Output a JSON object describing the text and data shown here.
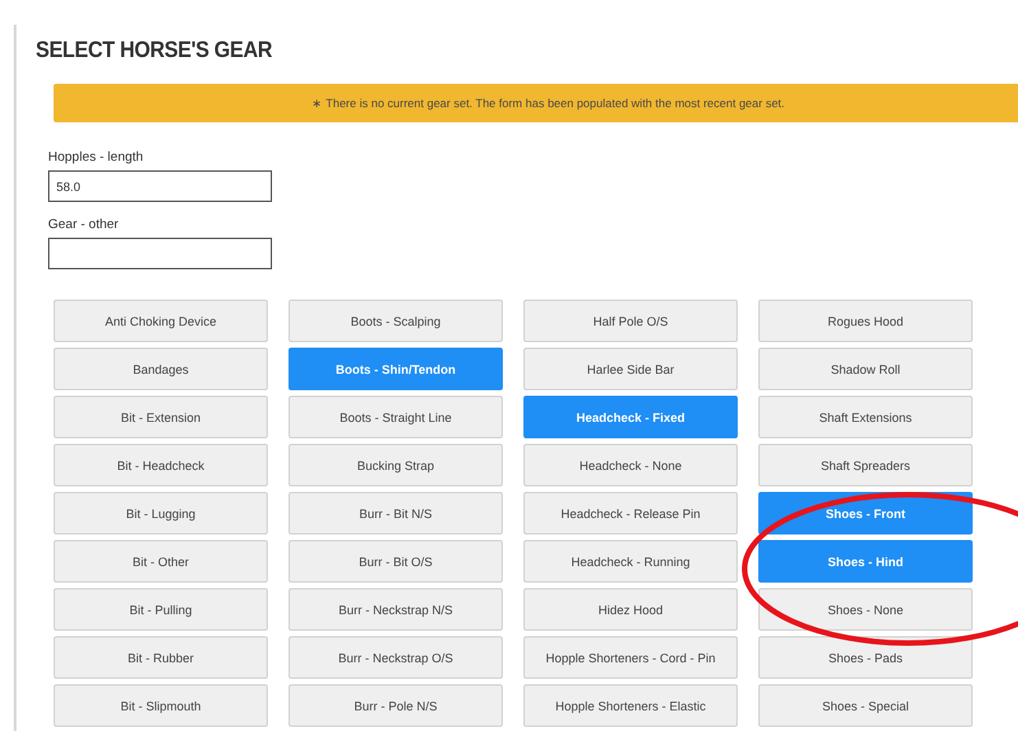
{
  "title": "SELECT HORSE'S GEAR",
  "notice": "∗ There is no current gear set. The form has been populated with the most recent gear set.",
  "fields": [
    {
      "label": "Hopples - length",
      "value": "58.0"
    },
    {
      "label": "Gear - other"
    }
  ],
  "gear_columns": [
    [
      {
        "label": "Anti Choking Device",
        "selected": false
      },
      {
        "label": "Bandages",
        "selected": false
      },
      {
        "label": "Bit - Extension",
        "selected": false
      },
      {
        "label": "Bit - Headcheck",
        "selected": false
      },
      {
        "label": "Bit - Lugging",
        "selected": false
      },
      {
        "label": "Bit - Other",
        "selected": false
      },
      {
        "label": "Bit - Pulling",
        "selected": false
      },
      {
        "label": "Bit - Rubber",
        "selected": false
      },
      {
        "label": "Bit - Slipmouth",
        "selected": false
      }
    ],
    [
      {
        "label": "Boots - Scalping",
        "selected": false
      },
      {
        "label": "Boots - Shin/Tendon",
        "selected": true
      },
      {
        "label": "Boots - Straight Line",
        "selected": false
      },
      {
        "label": "Bucking Strap",
        "selected": false
      },
      {
        "label": "Burr - Bit N/S",
        "selected": false
      },
      {
        "label": "Burr - Bit O/S",
        "selected": false
      },
      {
        "label": "Burr - Neckstrap N/S",
        "selected": false
      },
      {
        "label": "Burr - Neckstrap O/S",
        "selected": false
      },
      {
        "label": "Burr - Pole N/S",
        "selected": false
      }
    ],
    [
      {
        "label": "Half Pole O/S",
        "selected": false
      },
      {
        "label": "Harlee Side Bar",
        "selected": false
      },
      {
        "label": "Headcheck - Fixed",
        "selected": true
      },
      {
        "label": "Headcheck - None",
        "selected": false
      },
      {
        "label": "Headcheck - Release Pin",
        "selected": false
      },
      {
        "label": "Headcheck - Running",
        "selected": false
      },
      {
        "label": "Hidez Hood",
        "selected": false
      },
      {
        "label": "Hopple Shorteners - Cord - Pin",
        "selected": false
      },
      {
        "label": "Hopple Shorteners - Elastic",
        "selected": false
      }
    ],
    [
      {
        "label": "Rogues Hood",
        "selected": false
      },
      {
        "label": "Shadow Roll",
        "selected": false
      },
      {
        "label": "Shaft Extensions",
        "selected": false
      },
      {
        "label": "Shaft Spreaders",
        "selected": false
      },
      {
        "label": "Shoes - Front",
        "selected": true
      },
      {
        "label": "Shoes - Hind",
        "selected": true
      },
      {
        "label": "Shoes - None",
        "selected": false
      },
      {
        "label": "Shoes - Pads",
        "selected": false
      },
      {
        "label": "Shoes - Special",
        "selected": false
      }
    ]
  ]
}
